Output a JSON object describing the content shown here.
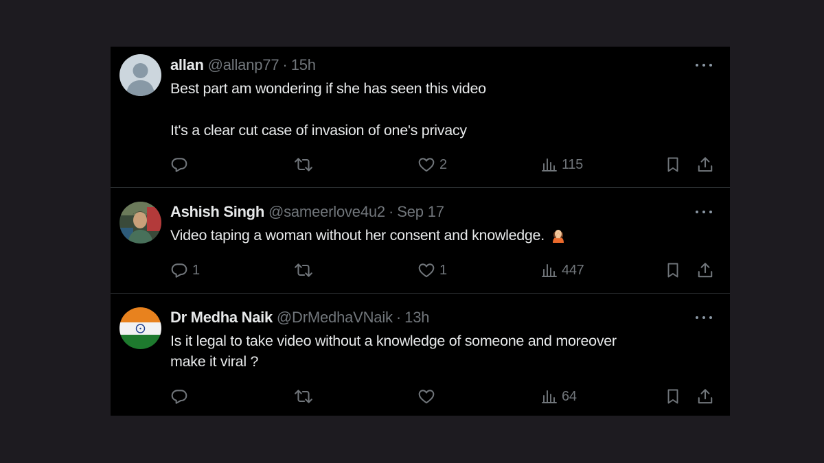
{
  "colors": {
    "background": "#1d1b20",
    "card": "#000000",
    "text_primary": "#e7e9ea",
    "text_secondary": "#71767b",
    "divider": "#2f3336"
  },
  "tweets": [
    {
      "name": "allan",
      "handle": "@allanp77",
      "separator": "·",
      "time": "15h",
      "avatar": "default-avatar-icon",
      "lines": [
        "Best part am wondering if she has seen this video",
        "It's a clear cut case of invasion of one's privacy"
      ],
      "replies": "",
      "retweets": "",
      "likes": "2",
      "views": "115"
    },
    {
      "name": "Ashish Singh",
      "handle": "@sameerlove4u2",
      "separator": "·",
      "time": "Sep 17",
      "avatar": "profile-photo",
      "lines": [
        "Video taping a woman without her consent and knowledge."
      ],
      "emoji": "woman-facepalming-emoji",
      "replies": "1",
      "retweets": "",
      "likes": "1",
      "views": "447"
    },
    {
      "name": "Dr Medha Naik",
      "handle": "@DrMedhaVNaik",
      "separator": "·",
      "time": "13h",
      "avatar": "india-flag-avatar",
      "lines": [
        "Is it legal to take video without a knowledge of someone and moreover",
        "make it viral ?"
      ],
      "replies": "",
      "retweets": "",
      "likes": "",
      "views": "64"
    }
  ]
}
